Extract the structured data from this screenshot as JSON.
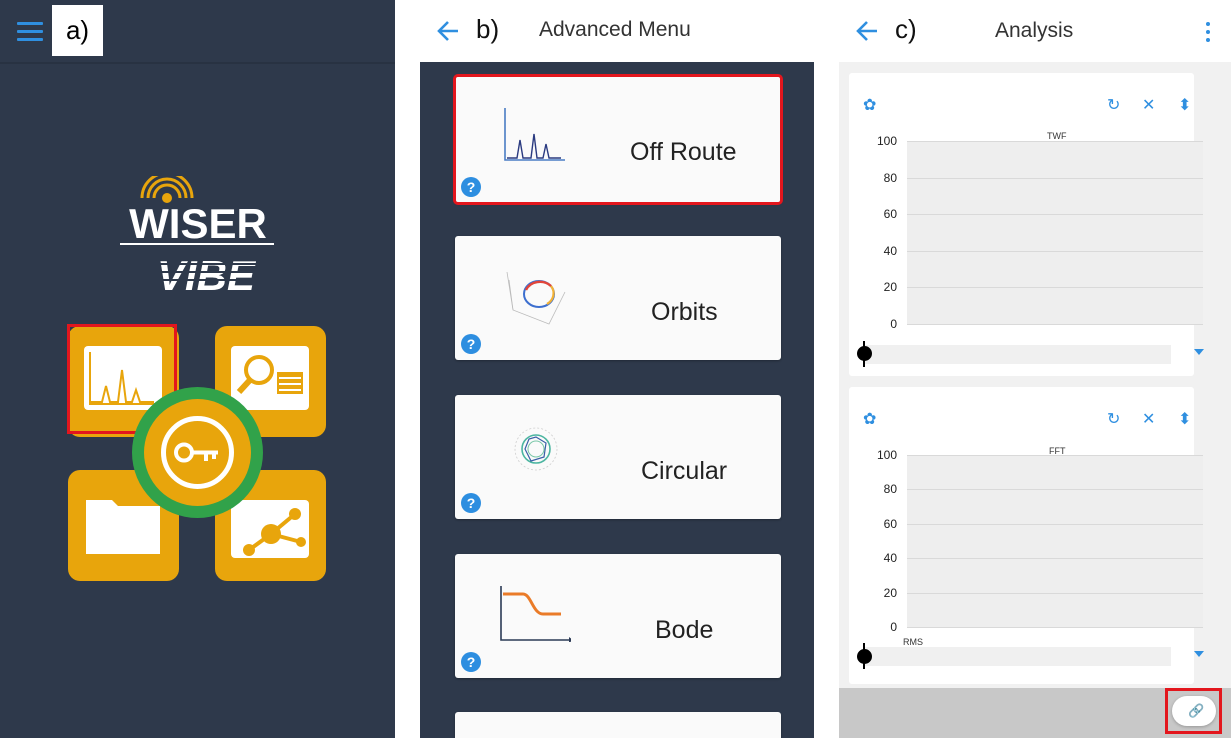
{
  "panel_a": {
    "label": "a)",
    "logo": {
      "line1": "WISER",
      "line2": "VIBE"
    }
  },
  "panel_b": {
    "label": "b)",
    "title": "Advanced Menu",
    "cards": [
      {
        "label": "Off Route",
        "icon": "spectrum-icon"
      },
      {
        "label": "Orbits",
        "icon": "orbit-plot-icon"
      },
      {
        "label": "Circular",
        "icon": "circular-plot-icon"
      },
      {
        "label": "Bode",
        "icon": "bode-plot-icon"
      }
    ],
    "help_glyph": "?"
  },
  "panel_c": {
    "label": "c)",
    "title": "Analysis",
    "charts": [
      {
        "title": "TWF",
        "y_ticks": [
          "100",
          "80",
          "60",
          "40",
          "20",
          "0"
        ],
        "extra_label": ""
      },
      {
        "title": "FFT",
        "y_ticks": [
          "100",
          "80",
          "60",
          "40",
          "20",
          "0"
        ],
        "extra_label": "RMS"
      }
    ],
    "toolbar_glyphs": {
      "settings": "✿",
      "refresh": "↻",
      "close": "✕",
      "sort": "⬍"
    },
    "link_glyph": "🔗"
  },
  "colors": {
    "dark_bg": "#2e394b",
    "accent_blue": "#2f8fe0",
    "highlight_red": "#e3161d",
    "logo_gold": "#e8a50c",
    "logo_green": "#31a24a"
  }
}
